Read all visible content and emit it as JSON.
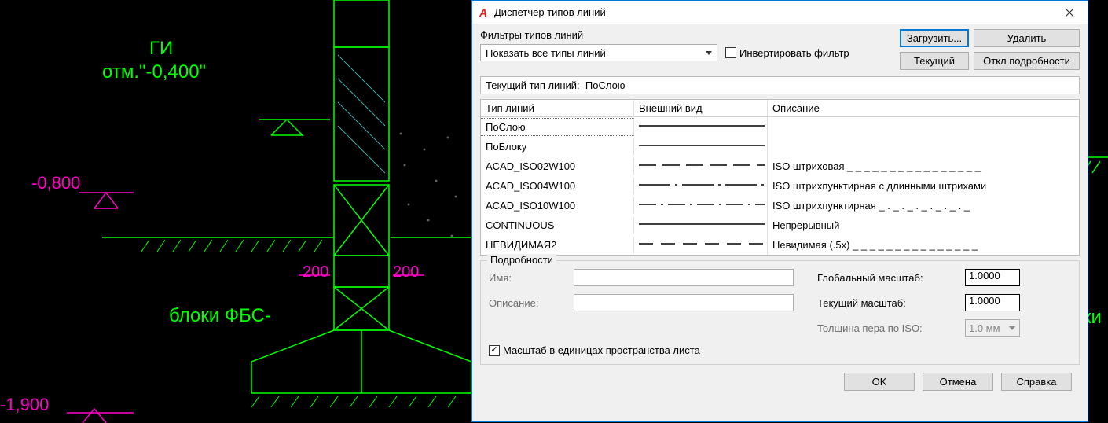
{
  "cad": {
    "label_gi": "ГИ",
    "label_elev": "отм.\"-0,400\"",
    "elev_08": "-0,800",
    "elev_19": "-1,900",
    "dim_200a": "200",
    "dim_200b": "200",
    "label_fbs": "блоки ФБС-",
    "label_ki": "ки"
  },
  "dialog": {
    "title": "Диспетчер типов линий",
    "filter_legend": "Фильтры типов линий",
    "filter_selected": "Показать все типы линий",
    "invert_label": "Инвертировать фильтр",
    "btn_load": "Загрузить...",
    "btn_delete": "Удалить",
    "btn_current": "Текущий",
    "btn_hidedetails": "Откл подробности",
    "current_prefix": "Текущий тип линий:",
    "current_value": "ПоСлою",
    "headers": {
      "name": "Тип линий",
      "appearance": "Внешний вид",
      "desc": "Описание"
    },
    "rows": [
      {
        "name": "ПоСлою",
        "pattern": "solid",
        "desc": ""
      },
      {
        "name": "ПоБлоку",
        "pattern": "solid",
        "desc": ""
      },
      {
        "name": "ACAD_ISO02W100",
        "pattern": "dash",
        "desc": "ISO штриховая _ _ _ _ _ _ _ _ _ _ _ _ _ _ _ _"
      },
      {
        "name": "ACAD_ISO04W100",
        "pattern": "dashdotlong",
        "desc": "ISO штрихпунктирная с длинными штрихами"
      },
      {
        "name": "ACAD_ISO10W100",
        "pattern": "dashdot",
        "desc": "ISO штрихпунктирная _ . _ . _ . _ . _ . _ . _"
      },
      {
        "name": "CONTINUOUS",
        "pattern": "solid",
        "desc": "Непрерывный"
      },
      {
        "name": "НЕВИДИМАЯ2",
        "pattern": "hidden",
        "desc": "Невидимая (.5x) _ _ _ _ _ _ _ _ _ _ _ _ _ _ _"
      }
    ],
    "details": {
      "legend": "Подробности",
      "name_label": "Имя:",
      "desc_label": "Описание:",
      "global_scale_label": "Глобальный масштаб:",
      "global_scale_value": "1.0000",
      "current_scale_label": "Текущий масштаб:",
      "current_scale_value": "1.0000",
      "iso_pen_label": "Толщина пера по ISO:",
      "iso_pen_value": "1.0 мм",
      "paperspace_label": "Масштаб в единицах пространства листа"
    },
    "btn_ok": "OK",
    "btn_cancel": "Отмена",
    "btn_help": "Справка"
  }
}
